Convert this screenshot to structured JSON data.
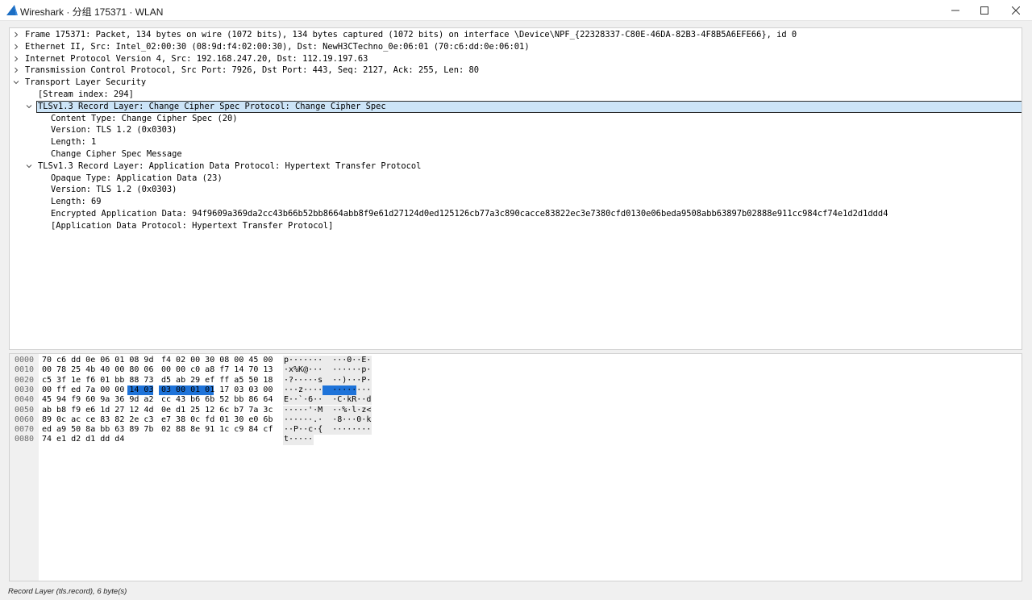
{
  "window": {
    "title": "Wireshark · 分组 175371 · WLAN",
    "controls": [
      "minimize-icon",
      "maximize-icon",
      "close-icon"
    ]
  },
  "tree": [
    {
      "text": "Frame 175371: Packet, 134 bytes on wire (1072 bits), 134 bytes captured (1072 bits) on interface \\Device\\NPF_{22328337-C80E-46DA-82B3-4F8B5A6EFE66}, id 0",
      "indent": 0,
      "expander": "collapsed"
    },
    {
      "text": "Ethernet II, Src: Intel_02:00:30 (08:9d:f4:02:00:30), Dst: NewH3CTechno_0e:06:01 (70:c6:dd:0e:06:01)",
      "indent": 0,
      "expander": "collapsed"
    },
    {
      "text": "Internet Protocol Version 4, Src: 192.168.247.20, Dst: 112.19.197.63",
      "indent": 0,
      "expander": "collapsed"
    },
    {
      "text": "Transmission Control Protocol, Src Port: 7926, Dst Port: 443, Seq: 2127, Ack: 255, Len: 80",
      "indent": 0,
      "expander": "collapsed"
    },
    {
      "text": "Transport Layer Security",
      "indent": 0,
      "expander": "expanded"
    },
    {
      "text": "[Stream index: 294]",
      "indent": 1,
      "expander": "none"
    },
    {
      "text": "TLSv1.3 Record Layer: Change Cipher Spec Protocol: Change Cipher Spec",
      "indent": 1,
      "expander": "expanded",
      "selected": true
    },
    {
      "text": "Content Type: Change Cipher Spec (20)",
      "indent": 2,
      "expander": "none"
    },
    {
      "text": "Version: TLS 1.2 (0x0303)",
      "indent": 2,
      "expander": "none"
    },
    {
      "text": "Length: 1",
      "indent": 2,
      "expander": "none"
    },
    {
      "text": "Change Cipher Spec Message",
      "indent": 2,
      "expander": "none"
    },
    {
      "text": "TLSv1.3 Record Layer: Application Data Protocol: Hypertext Transfer Protocol",
      "indent": 1,
      "expander": "expanded"
    },
    {
      "text": "Opaque Type: Application Data (23)",
      "indent": 2,
      "expander": "none"
    },
    {
      "text": "Version: TLS 1.2 (0x0303)",
      "indent": 2,
      "expander": "none"
    },
    {
      "text": "Length: 69",
      "indent": 2,
      "expander": "none"
    },
    {
      "text": "Encrypted Application Data: 94f9609a369da2cc43b66b52bb8664abb8f9e61d27124d0ed125126cb77a3c890cacce83822ec3e7380cfd0130e06beda9508abb63897b02888e911cc984cf74e1d2d1ddd4",
      "indent": 2,
      "expander": "none"
    },
    {
      "text": "[Application Data Protocol: Hypertext Transfer Protocol]",
      "indent": 2,
      "expander": "none"
    }
  ],
  "hex": [
    {
      "offset": "0000",
      "bytes1": "70 c6 dd 0e 06 01 08 9d",
      "bytes2": "f4 02 00 30 08 00 45 00",
      "ascii": "p·······  ···0··E·"
    },
    {
      "offset": "0010",
      "bytes1": "00 78 25 4b 40 00 80 06",
      "bytes2": "00 00 c0 a8 f7 14 70 13",
      "ascii": "·x%K@···  ······p·"
    },
    {
      "offset": "0020",
      "bytes1": "c5 3f 1e f6 01 bb 88 73",
      "bytes2": "d5 ab 29 ef ff a5 50 18",
      "ascii": "·?·····s  ··)···P·"
    },
    {
      "offset": "0030",
      "bytes1": "00 ff ed 7a 00 00 14 03",
      "bytes2": "03 00 01 01 17 03 03 00",
      "ascii": "···z····  ········"
    },
    {
      "offset": "0040",
      "bytes1": "45 94 f9 60 9a 36 9d a2",
      "bytes2": "cc 43 b6 6b 52 bb 86 64",
      "ascii": "E··`·6··  ·C·kR··d"
    },
    {
      "offset": "0050",
      "bytes1": "ab b8 f9 e6 1d 27 12 4d",
      "bytes2": "0e d1 25 12 6c b7 7a 3c",
      "ascii": "·····'·M  ··%·l·z<"
    },
    {
      "offset": "0060",
      "bytes1": "89 0c ac ce 83 82 2e c3",
      "bytes2": "e7 38 0c fd 01 30 e0 6b",
      "ascii": "······.·  ·8···0·k"
    },
    {
      "offset": "0070",
      "bytes1": "ed a9 50 8a bb 63 89 7b",
      "bytes2": "02 88 8e 91 1c c9 84 cf",
      "ascii": "··P··c·{  ········"
    },
    {
      "offset": "0080",
      "bytes1": "74 e1 d2 d1 dd d4",
      "bytes2": "",
      "ascii": "t·····"
    }
  ],
  "highlight": {
    "row": 3,
    "first_byte": 6,
    "last_byte": 11
  },
  "status": {
    "text": "Record Layer (tls.record), 6 byte(s)"
  }
}
